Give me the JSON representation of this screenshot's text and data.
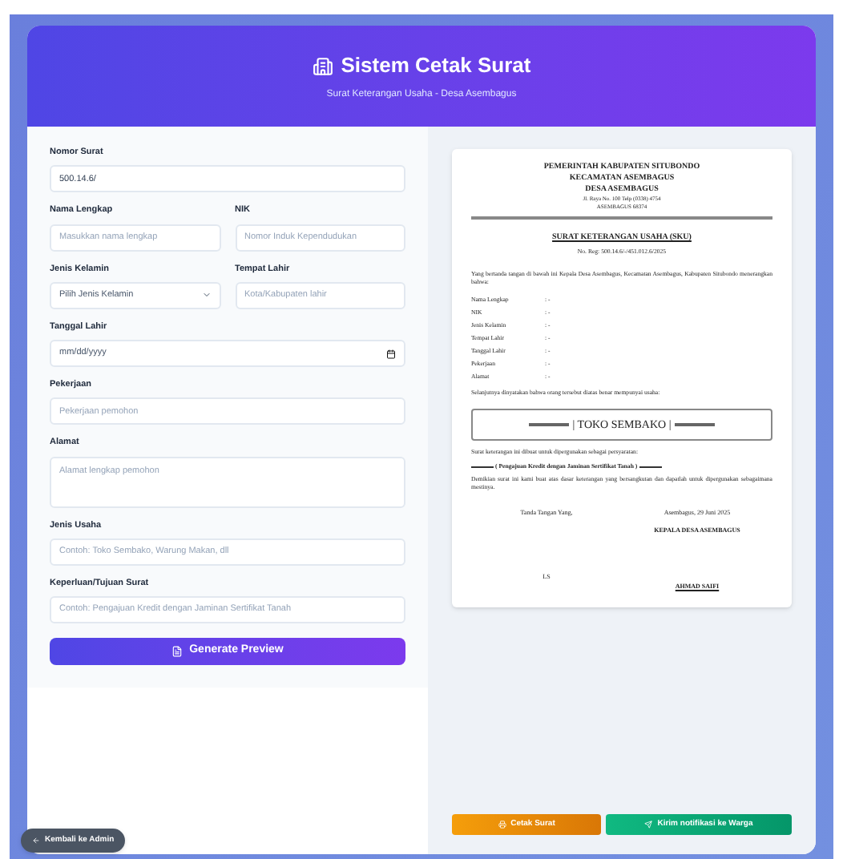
{
  "header": {
    "title": "Sistem Cetak Surat",
    "subtitle": "Surat Keterangan Usaha - Desa Asembagus"
  },
  "form": {
    "rows": [
      [
        {
          "label": "Nomor Surat",
          "kind": "input",
          "value": "500.14.6/"
        }
      ],
      [
        {
          "label": "Nama Lengkap",
          "kind": "input",
          "placeholder": "Masukkan nama lengkap"
        },
        {
          "label": "NIK",
          "kind": "input",
          "placeholder": "Nomor Induk Kependudukan"
        }
      ],
      [
        {
          "label": "Jenis Kelamin",
          "kind": "select",
          "value": "Pilih Jenis Kelamin"
        },
        {
          "label": "Tempat Lahir",
          "kind": "input",
          "placeholder": "Kota/Kabupaten lahir"
        }
      ],
      [
        {
          "label": "Tanggal Lahir",
          "kind": "date",
          "value": "mm/dd/yyyy"
        }
      ],
      [
        {
          "label": "Pekerjaan",
          "kind": "input",
          "placeholder": "Pekerjaan pemohon"
        }
      ],
      [
        {
          "label": "Alamat",
          "kind": "textarea",
          "placeholder": "Alamat lengkap pemohon"
        }
      ],
      [
        {
          "label": "Jenis Usaha",
          "kind": "input",
          "placeholder": "Contoh: Toko Sembako, Warung Makan, dll"
        }
      ],
      [
        {
          "label": "Keperluan/Tujuan Surat",
          "kind": "input",
          "placeholder": "Contoh: Pengajuan Kredit dengan Jaminan Sertifikat Tanah"
        }
      ]
    ],
    "submit": "Generate Preview"
  },
  "letter": {
    "letterhead": [
      "PEMERINTAH KABUPATEN SITUBONDO",
      "KECAMATAN ASEMBAGUS",
      "DESA ASEMBAGUS"
    ],
    "address": [
      "Jl. Raya No. 100 Telp (0338) 4754",
      "ASEMBAGUS 68374"
    ],
    "title": "SURAT KETERANGAN USAHA (SKU)",
    "number": "No. Reg: 500.14.6/-/451.012.6/2025",
    "opening": "Yang bertanda tangan di bawah ini Kepala Desa Asembagus, Kecamatan Asembagus, Kabupaten Situbondo menerangkan bahwa:",
    "fields": [
      {
        "label": "Nama Lengkap",
        "value": ": -"
      },
      {
        "label": "NIK",
        "value": ": -"
      },
      {
        "label": "Jenis Kelamin",
        "value": ": -"
      },
      {
        "label": "Tempat Lahir",
        "value": ": -"
      },
      {
        "label": "Tanggal Lahir",
        "value": ": -"
      },
      {
        "label": "Pekerjaan",
        "value": ": -"
      },
      {
        "label": "Alamat",
        "value": ": -"
      }
    ],
    "business_intro": "Selanjutnya dinyatakan bahwa orang tersebut diatas benar mempunyai usaha:",
    "business": "| TOKO SEMBAKO |",
    "purpose_intro": "Surat keterangan ini dibuat untuk dipergunakan sebagai persyaratan:",
    "purpose": "( Pengajuan Kredit dengan Jaminan Sertifikat Tanah )",
    "closing": "Demikian surat ini kami buat atas dasar keterangan yang bersangkutan dan dapatlah untuk dipergunakan sebagaimana mestinya.",
    "sign_left": "Tanda Tangan Yang,",
    "place_date": "Asembagus, 29 Juni 2025",
    "official_title": "KEPALA DESA ASEMBAGUS",
    "stamp": "LS",
    "official_name": "AHMAD SAIFI"
  },
  "actions": {
    "print": "Cetak Surat",
    "notify": "Kirim notifikasi ke Warga"
  },
  "back": "Kembali ke Admin"
}
